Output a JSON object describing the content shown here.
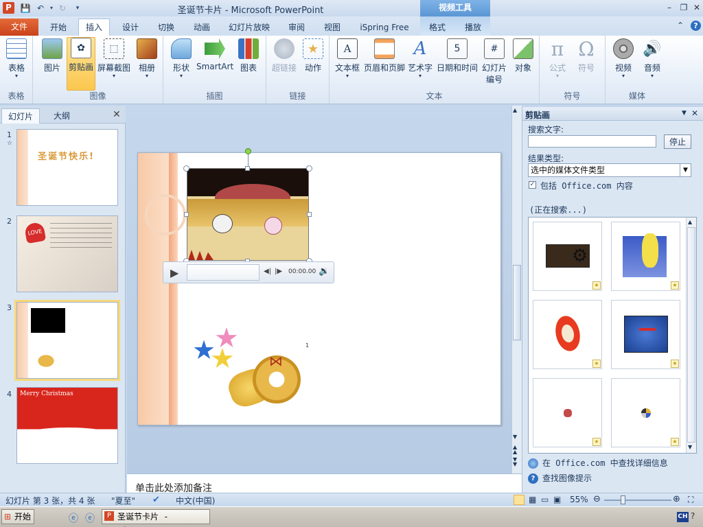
{
  "titlebar": {
    "app_icon": "P",
    "title": "圣诞节卡片 - Microsoft PowerPoint",
    "context_tab": "视频工具"
  },
  "tabs": [
    "文件",
    "开始",
    "插入",
    "设计",
    "切换",
    "动画",
    "幻灯片放映",
    "审阅",
    "视图",
    "iSpring Free",
    "格式",
    "播放"
  ],
  "ribbon": {
    "groups": {
      "table": "表格",
      "images": "图像",
      "illustrations": "插图",
      "links": "链接",
      "text": "文本",
      "symbols": "符号",
      "media": "媒体"
    },
    "buttons": {
      "table": "表格",
      "picture": "图片",
      "clipart": "剪贴画",
      "screenshot": "屏幕截图",
      "album": "相册",
      "shapes": "形状",
      "smartart": "SmartArt",
      "chart": "图表",
      "hyperlink": "超链接",
      "action": "动作",
      "textbox": "文本框",
      "header_footer": "页眉和页脚",
      "wordart": "艺术字",
      "datetime": "日期和时间",
      "slide_number_1": "幻灯片",
      "slide_number_2": "编号",
      "object": "对象",
      "equation": "公式",
      "symbol": "符号",
      "video": "视频",
      "audio": "音频"
    }
  },
  "leftpane": {
    "tab_slides": "幻灯片",
    "tab_outline": "大纲",
    "slides": [
      {
        "num": "1",
        "text": "圣诞节快乐!"
      },
      {
        "num": "2",
        "text": "LOVE"
      },
      {
        "num": "3",
        "text": ""
      },
      {
        "num": "4",
        "text": "Merry Christmas"
      }
    ]
  },
  "player": {
    "time": "00:00.00"
  },
  "slide": {
    "page_marker": "1"
  },
  "notes": {
    "placeholder": "单击此处添加备注"
  },
  "clippane": {
    "title": "剪贴画",
    "search_label": "搜索文字:",
    "search_value": "",
    "stop_button": "停止",
    "result_type_label": "结果类型:",
    "result_type_value": "选中的媒体文件类型",
    "include_office": "包括 Office.com 内容",
    "searching": "(正在搜索...)",
    "link_office": "在 Office.com 中查找详细信息",
    "link_tips": "查找图像提示"
  },
  "statusbar": {
    "slide_info": "幻灯片 第 3 张，共 4 张",
    "theme": "\"夏至\"",
    "language": "中文(中国)",
    "zoom": "55%"
  },
  "taskbar": {
    "start": "开始",
    "ppt_task": "圣诞节卡片 - Micros...",
    "tray_lang": "CH"
  },
  "colors": {
    "file_tab": "#d24726",
    "context_tab": "#5a96d4",
    "selected_thumb": "#f7d87a"
  }
}
